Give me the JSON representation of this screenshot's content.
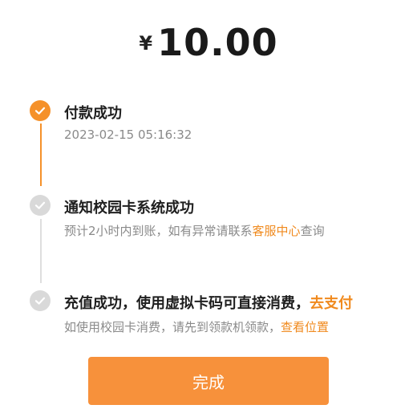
{
  "payment": {
    "currency_symbol": "¥",
    "amount": "10.00"
  },
  "steps": [
    {
      "status": "done",
      "title": "付款成功",
      "subtitle": "2023-02-15 05:16:32"
    },
    {
      "status": "pending",
      "title": "通知校园卡系统成功",
      "subtitle_prefix": "预计2小时内到账，如有异常请联系",
      "subtitle_link": "客服中心",
      "subtitle_suffix": "查询"
    },
    {
      "status": "pending",
      "title_prefix": "充值成功，使用虚拟卡码可直接消费，",
      "title_link": "去支付",
      "subtitle_prefix": "如使用校园卡消费，请先到领款机领款，",
      "subtitle_link": "查看位置"
    }
  ],
  "colors": {
    "accent": "#f5912a",
    "pending": "#d9d9d9",
    "button": "#f7913b"
  },
  "icons": {
    "done": "check-circle-icon",
    "pending": "check-circle-icon"
  },
  "button": {
    "label": "完成"
  }
}
